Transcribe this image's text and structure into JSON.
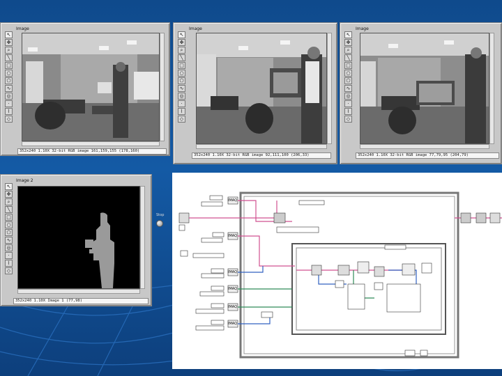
{
  "windows": [
    {
      "title": "Image",
      "status": "352x240 1.10X 32-bit RGB image 161,159,155   (178,160)"
    },
    {
      "title": "Image",
      "status": "352x240 1.10X 32-bit RGB image 92,111,100   (206,33)"
    },
    {
      "title": "Image",
      "status": "352x240 1.10X 32-bit RGB image 77,79,95   (204,79)"
    },
    {
      "title": "Image 2",
      "status": "352x240 1.10X Image 1   (77,98)"
    }
  ],
  "tool_icons": [
    "cursor-icon",
    "pan-icon",
    "zoom-icon",
    "line-icon",
    "rect-icon",
    "oval-icon",
    "polygon-icon",
    "freehand-icon",
    "annulus-icon",
    "point-icon",
    "broken-line-icon",
    "rotated-rect-icon"
  ],
  "side_control": {
    "label": "Stop"
  },
  "block_diagram": {
    "nodes": [
      {
        "label": "IMAQ",
        "kind": "function"
      },
      {
        "label": "IMAQ",
        "kind": "function"
      },
      {
        "label": "IMAQ",
        "kind": "function"
      },
      {
        "label": "IMAQ",
        "kind": "function"
      },
      {
        "label": "IMAQ",
        "kind": "function"
      },
      {
        "label": "IMAQ",
        "kind": "function"
      }
    ]
  },
  "colors": {
    "background": "#145aa5",
    "window": "#c8c8c8",
    "wire_pink": "#d05090",
    "wire_blue": "#3060c0",
    "wire_green": "#2e8b57"
  }
}
